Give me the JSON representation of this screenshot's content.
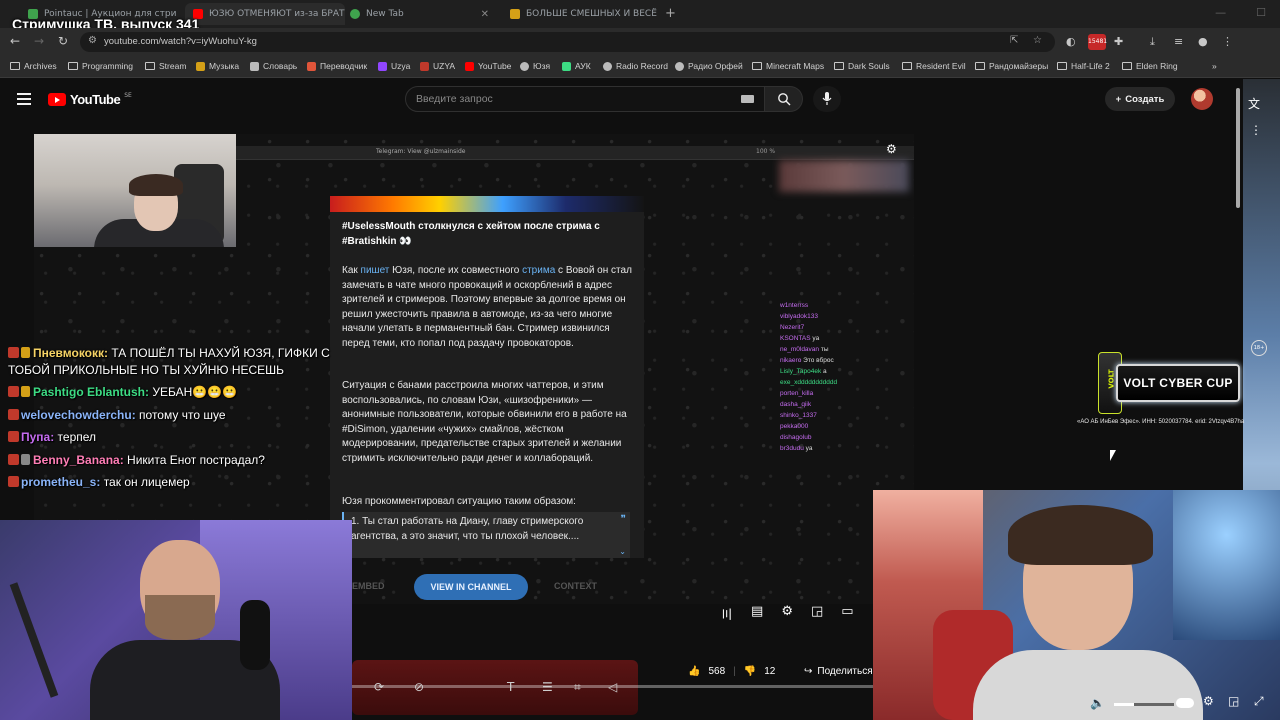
{
  "overlay_title": "Стримушка ТВ, выпуск 341",
  "tabs": [
    {
      "label": "Pointauc | Аукцион для стри",
      "color": "#3fa34d"
    },
    {
      "label": "ЮЗЮ ОТМЕНЯЮТ из-за БРАТ",
      "color": "#ff0000"
    },
    {
      "label": "New Tab",
      "color": "#3fa34d"
    },
    {
      "label": "БОЛЬШЕ СМЕШНЫХ И ВЕСЁЛ",
      "color": "#d4a017"
    }
  ],
  "address": {
    "url": "youtube.com/watch?v=iyWuohuY-kg",
    "ext_badge": "15481"
  },
  "bookmarks": [
    {
      "label": "Archives",
      "icon": "folder"
    },
    {
      "label": "Programming",
      "icon": "folder"
    },
    {
      "label": "Stream",
      "icon": "folder"
    },
    {
      "label": "Музыка",
      "icon": "site"
    },
    {
      "label": "Словарь",
      "icon": "site"
    },
    {
      "label": "Переводчик",
      "icon": "site"
    },
    {
      "label": "Uzya",
      "icon": "site"
    },
    {
      "label": "UZYA",
      "icon": "site"
    },
    {
      "label": "YouTube",
      "icon": "site"
    },
    {
      "label": "Юзя",
      "icon": "site"
    },
    {
      "label": "АУК",
      "icon": "site"
    },
    {
      "label": "Radio Record",
      "icon": "site"
    },
    {
      "label": "Радио Орфей",
      "icon": "site"
    },
    {
      "label": "Minecraft Maps",
      "icon": "folder"
    },
    {
      "label": "Dark Souls",
      "icon": "folder"
    },
    {
      "label": "Resident Evil",
      "icon": "folder"
    },
    {
      "label": "Рандомайзеры",
      "icon": "folder"
    },
    {
      "label": "Half-Life 2",
      "icon": "folder"
    },
    {
      "label": "Elden Ring",
      "icon": "folder"
    }
  ],
  "youtube": {
    "logo_text": "YouTube",
    "region": "SE",
    "search_placeholder": "Введите запрос",
    "create_label": "Создать"
  },
  "telegram": {
    "window_title": "Telegram: View @ulzmainside",
    "zoom": "100 %",
    "heading": "#UselessMouth столкнулся с хейтом после стрима с #Bratishkin 👀",
    "p1_a": "Как ",
    "p1_link1": "пишет",
    "p1_b": " Юзя, после их совместного ",
    "p1_link2": "стрима",
    "p1_c": " с Вовой он стал замечать в чате много провокаций и оскорблений в адрес зрителей и стримеров. Поэтому впервые за долгое время он решил ужесточить правила в автомоде, из-за чего многие начали улетать в перманентный бан. Стример извинился перед теми, кто попал под раздачу провокаторов.",
    "p2": "Ситуация с банами расстроила многих чаттеров, и этим воспользовались, по словам Юзи, «шизофреники» — анонимные пользователи, которые обвинили его в работе на #DiSimon, удалении «чужих» смайлов, жёстком модерировании, предательстве старых зрителей и желании стримить исключительно ради денег и коллабораций.",
    "p3": "Юзя прокомментировал ситуацию таким образом:",
    "quote": "1. Ты стал работать на Диану, главу стримерского агентства, а это значит, что ты плохой человек....",
    "embed_label": "EMBED",
    "view_label": "VIEW IN CHANNEL",
    "context_label": "CONTEXT"
  },
  "mini_chat": [
    {
      "nick": "w1nterrss",
      "msg": "",
      "color": "#c56cf0"
    },
    {
      "nick": "viblyadok133",
      "msg": "",
      "color": "#c56cf0"
    },
    {
      "nick": "Nezerit7",
      "msg": "",
      "color": "#c56cf0"
    },
    {
      "nick": "KSONTAS",
      "msg": "ya",
      "color": "#c56cf0"
    },
    {
      "nick": "ne_m0ldavan",
      "msg": "ты",
      "color": "#c56cf0"
    },
    {
      "nick": "nikaero",
      "msg": "Это вброс",
      "color": "#c56cf0"
    },
    {
      "nick": "Lisly_Tapo4ek",
      "msg": "а",
      "color": "#3ddc84"
    },
    {
      "nick": "exe_xddddddddddd",
      "msg": "",
      "color": "#3ddc84"
    },
    {
      "nick": "porten_killa",
      "msg": "",
      "color": "#c56cf0"
    },
    {
      "nick": "dasha_qiik",
      "msg": "",
      "color": "#c56cf0"
    },
    {
      "nick": "shinko_1337",
      "msg": "",
      "color": "#c56cf0"
    },
    {
      "nick": "pekka000",
      "msg": "",
      "color": "#c56cf0"
    },
    {
      "nick": "dishagolub",
      "msg": "",
      "color": "#c56cf0"
    },
    {
      "nick": "br3dudu",
      "msg": "ya",
      "color": "#c56cf0"
    }
  ],
  "stream_chat": [
    {
      "nick": "Пневмококк:",
      "msg": " ТА ПОШЁЛ ТЫ НАХУЙ ЮЗЯ, ГИФКИ С ТОБОЙ ПРИКОЛЬНЫЕ НО ТЫ ХУЙНЮ НЕСЕШЬ",
      "color": "#f6d365",
      "badge2": true
    },
    {
      "nick": "Pashtigo Eblantush:",
      "msg": " УЕБАН😬😬😬",
      "color": "#3ddc84",
      "badge2": true
    },
    {
      "nick": "welovechowderchu:",
      "msg": " потому что шуе",
      "color": "#8ab4f8",
      "badge2": false
    },
    {
      "nick": "Пупа:",
      "msg": " терпел",
      "color": "#c56cf0",
      "badge2": false
    },
    {
      "nick": "Benny_Banana:",
      "msg": " Никита Енот пострадал?",
      "color": "#ff7eb6",
      "badge2": true
    },
    {
      "nick": "prometheu_s:",
      "msg": " так он лицемер",
      "color": "#8ab4f8",
      "badge2": false
    }
  ],
  "banner": {
    "title": "VOLT CYBER CUP",
    "can_text": "VOLT",
    "legal": "«АО АБ ИнБев Эфес». ИНН: 5020037784. erid: 2Vtzqv4B7ha",
    "age": "18+"
  },
  "player": {
    "likes": "568",
    "dislikes": "12",
    "share_label": "Поделиться"
  }
}
